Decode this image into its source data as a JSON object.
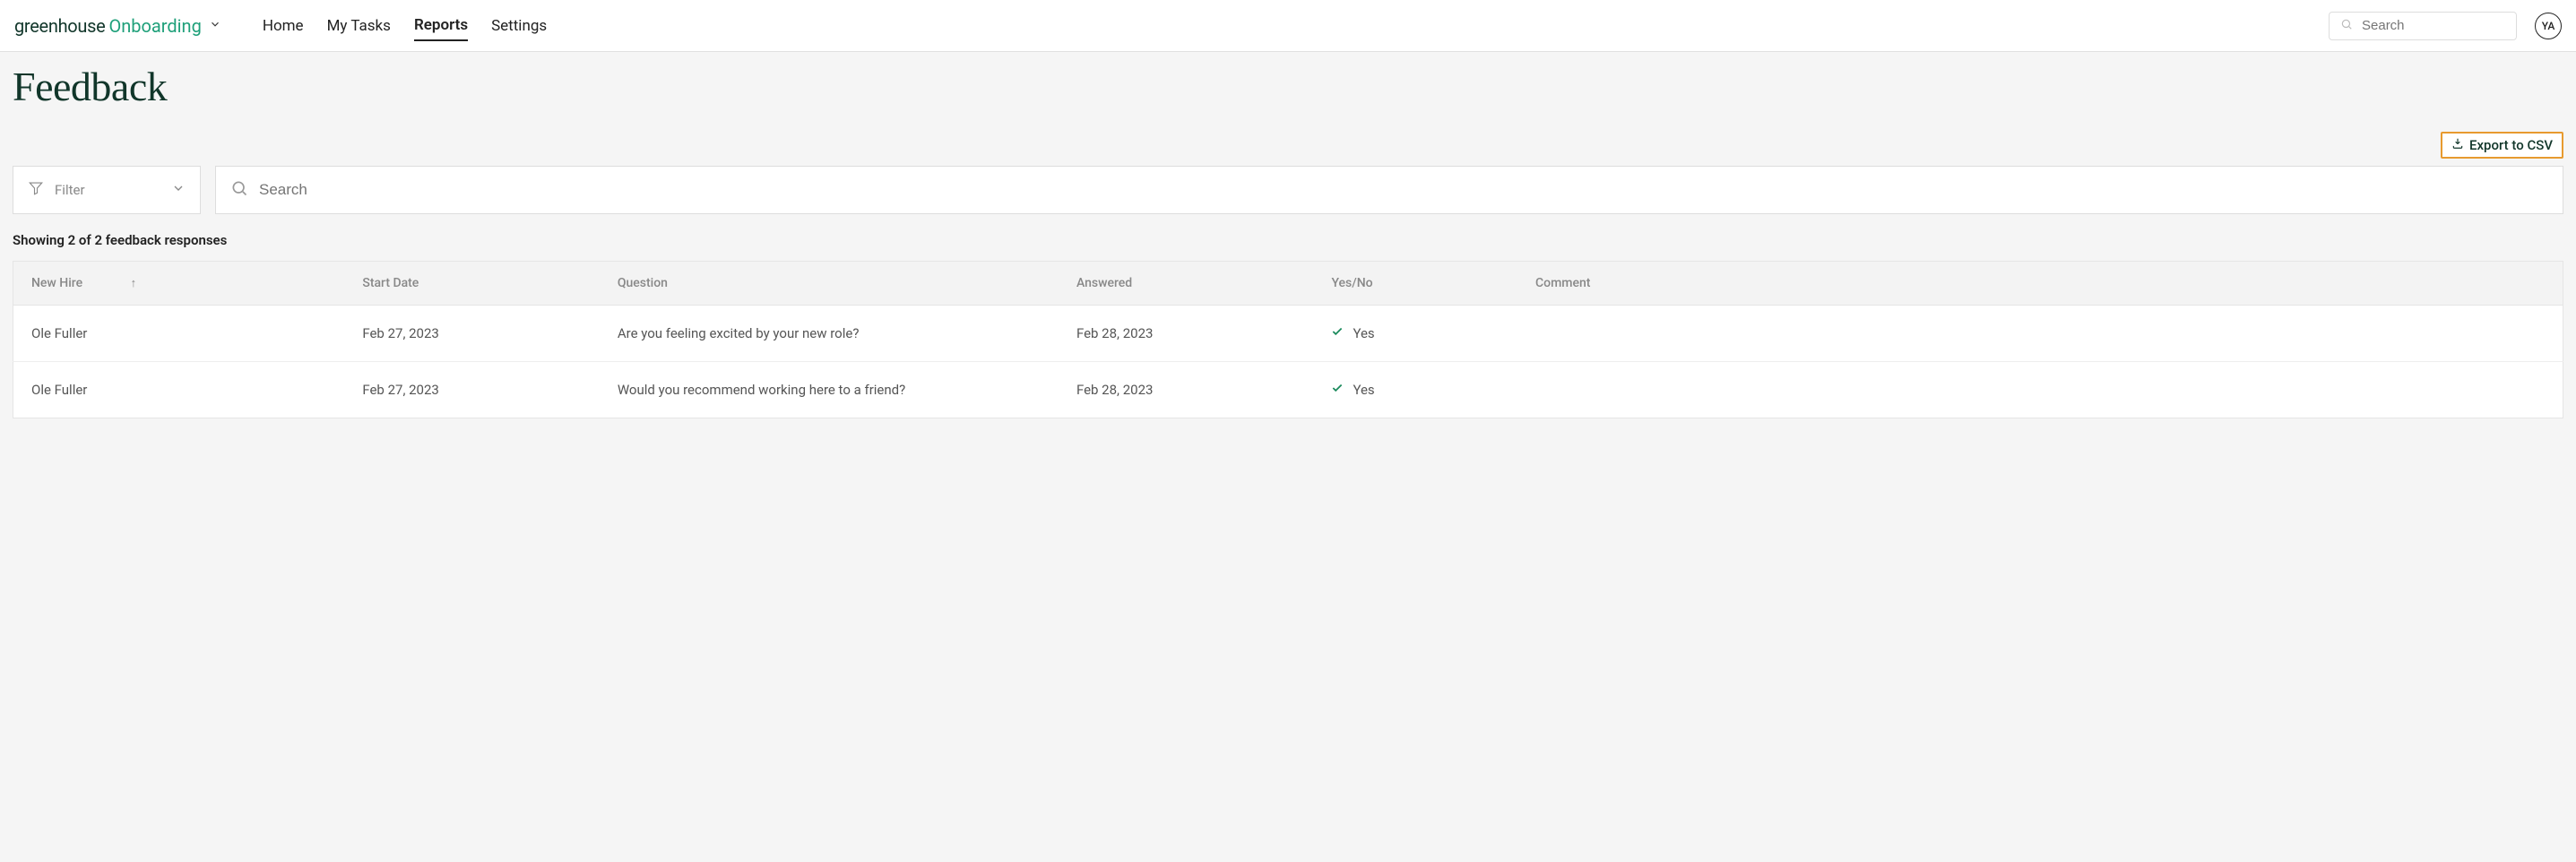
{
  "header": {
    "logo_primary": "greenhouse",
    "logo_secondary": "Onboarding",
    "nav": {
      "home": "Home",
      "my_tasks": "My Tasks",
      "reports": "Reports",
      "settings": "Settings"
    },
    "search_placeholder": "Search",
    "avatar_initials": "YA"
  },
  "page": {
    "title": "Feedback",
    "export_label": "Export to CSV",
    "filter_label": "Filter",
    "search_placeholder": "Search",
    "result_count": "Showing 2 of 2 feedback responses"
  },
  "table": {
    "headers": {
      "new_hire": "New Hire",
      "start_date": "Start Date",
      "question": "Question",
      "answered": "Answered",
      "yes_no": "Yes/No",
      "comment": "Comment"
    },
    "rows": [
      {
        "new_hire": "Ole Fuller",
        "start_date": "Feb 27, 2023",
        "question": "Are you feeling excited by your new role?",
        "answered": "Feb 28, 2023",
        "yes_no": "Yes",
        "comment": ""
      },
      {
        "new_hire": "Ole Fuller",
        "start_date": "Feb 27, 2023",
        "question": "Would you recommend working here to a friend?",
        "answered": "Feb 28, 2023",
        "yes_no": "Yes",
        "comment": ""
      }
    ]
  }
}
